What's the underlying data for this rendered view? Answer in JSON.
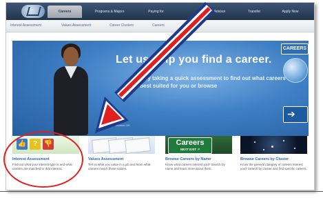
{
  "nav": {
    "tabs": [
      {
        "label": "Careers",
        "active": true
      },
      {
        "label": "Programs & Majors",
        "active": false
      },
      {
        "label": "Paying for",
        "active": false
      },
      {
        "label": "Advisor",
        "active": false
      },
      {
        "label": "Transfer",
        "active": false
      },
      {
        "label": "Apply Now",
        "active": false
      }
    ]
  },
  "subnav": {
    "items": [
      "Interest Assessment",
      "Values Assessment",
      "Career Clusters",
      "Careers"
    ]
  },
  "hero": {
    "title": "Let us help you find a career.",
    "subtitle": "Start by taking a quick assessment to find out what careers are best suited for you or browse",
    "link": "Browse Off",
    "badge": "CAREERS"
  },
  "cards": [
    {
      "title": "Interest Assessment",
      "desc": "Find out what your interest type is and what careers are matched to that interest."
    },
    {
      "title": "Values Assessment",
      "desc": "Tell us what you value in a job and learn what careers match those values."
    },
    {
      "title": "Browse Careers by Name",
      "desc": "Know what careers interest you? Search by name and learn more about them."
    },
    {
      "title": "Browse Careers by Cluster",
      "desc": "Know the general category of careers interest you? Search by cluster and find specific careers."
    }
  ],
  "card_images": {
    "careers_sign_main": "Careers",
    "careers_sign_sub": "NEXT EXIT ↗"
  },
  "colors": {
    "annotation_red": "#e02020",
    "annotation_outline": "#1f3a8a",
    "link_blue": "#2d64b0",
    "nav_dark": "#22344d"
  }
}
